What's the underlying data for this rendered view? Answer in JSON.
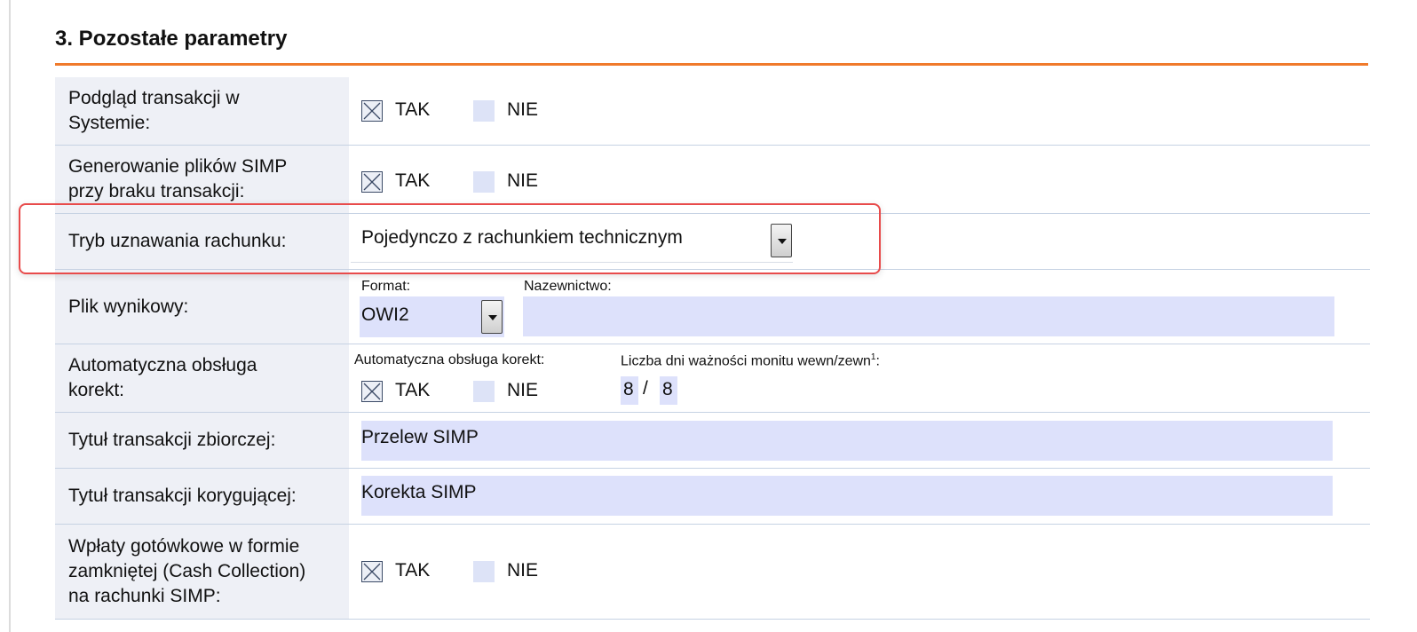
{
  "section": {
    "title": "3. Pozostałe parametry"
  },
  "options": {
    "yes": "TAK",
    "no": "NIE"
  },
  "rows": {
    "podglad": {
      "label_lines": [
        "Podgląd transakcji w",
        "Systemie:"
      ],
      "value": "TAK"
    },
    "generowanie": {
      "label_lines": [
        "Generowanie plików SIMP",
        "przy braku transakcji:"
      ],
      "value": "TAK"
    },
    "tryb": {
      "label": "Tryb uznawania rachunku:",
      "selected": "Pojedynczo z rachunkiem technicznym"
    },
    "plik": {
      "label": "Plik wynikowy:",
      "format_label": "Format:",
      "format_value": "OWI2",
      "naming_label": "Nazewnictwo:",
      "naming_value": ""
    },
    "korekty": {
      "label_lines": [
        "Automatyczna obsługa",
        "korekt:"
      ],
      "sub_label": "Automatyczna obsługa korekt:",
      "value": "TAK",
      "days_label": "Liczba dni ważności monitu wewn/zewn",
      "days_footnote": "1",
      "days_suffix": ":",
      "days_internal": "8",
      "days_separator": "/",
      "days_external": "8"
    },
    "tytul_zbiorczej": {
      "label": "Tytuł transakcji zbiorczej:",
      "value": "Przelew SIMP"
    },
    "tytul_korygujacej": {
      "label": "Tytuł transakcji korygującej:",
      "value": "Korekta SIMP"
    },
    "wplaty": {
      "label_lines": [
        "Wpłaty gotówkowe w formie",
        "zamkniętej (Cash Collection)",
        "na rachunki SIMP:"
      ],
      "value": "TAK"
    }
  },
  "colors": {
    "accent_orange": "#f07a2b",
    "label_background": "#eef0f6",
    "field_background": "#dde1fb",
    "highlight_border": "#e84b4b"
  }
}
